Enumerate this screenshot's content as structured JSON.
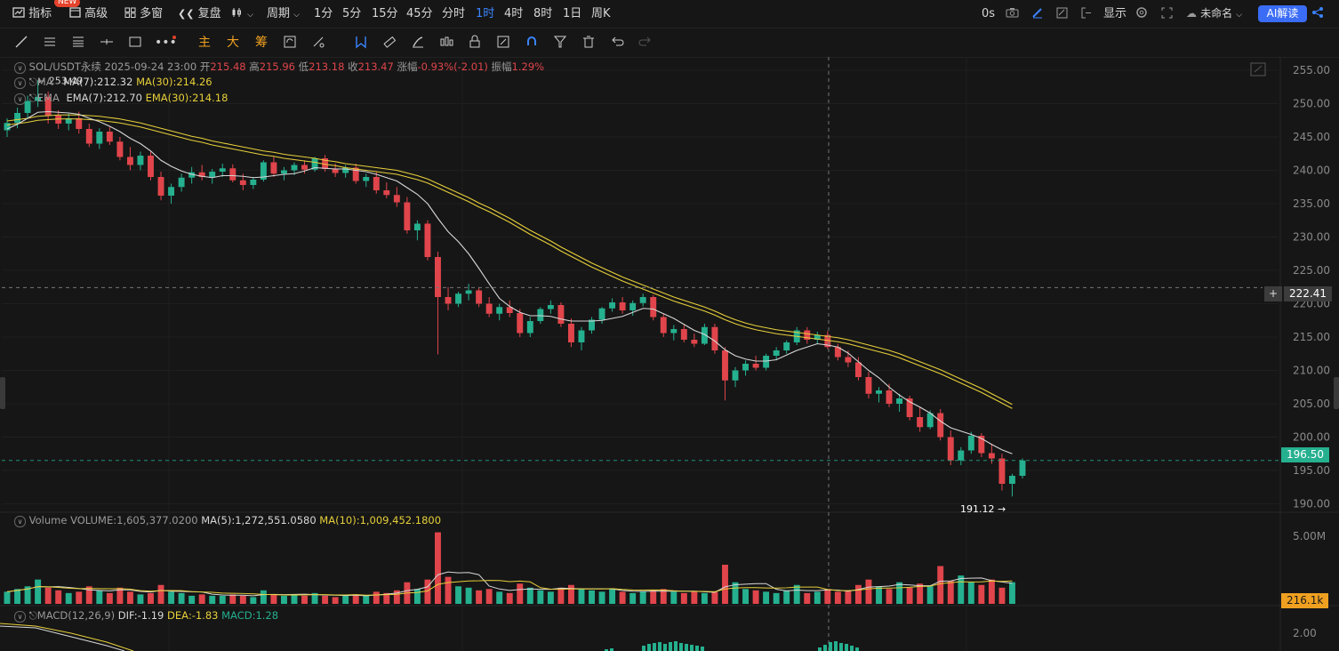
{
  "topbar": {
    "indicator": "指标",
    "new_badge": "NEW",
    "advanced": "高级",
    "multi_window": "多窗",
    "replay": "复盘",
    "period": "周期",
    "intervals": [
      "1分",
      "5分",
      "15分",
      "45分",
      "分时",
      "1时",
      "4时",
      "8时",
      "1日",
      "周K"
    ],
    "active_interval": "1时",
    "countdown": "0s",
    "display": "显示",
    "layout_name": "未命名",
    "ai_button": "AI解读"
  },
  "drawbar": {
    "main": "主",
    "big": "大",
    "chip": "筹"
  },
  "main_legend": {
    "symbol": "SOL/USDT永续",
    "datetime": "2025-09-24 23:00",
    "open_label": "开",
    "open": "215.48",
    "high_label": "高",
    "high": "215.96",
    "low_label": "低",
    "low": "213.18",
    "close_label": "收",
    "close": "213.47",
    "change_label": "涨幅",
    "change": "-0.93%(-2.01)",
    "amp_label": "振幅",
    "amp": "1.29%",
    "ma_name": "MA",
    "ma7": "MA(7):212.32",
    "ma30": "MA(30):214.26",
    "ema_name": "EMA",
    "ema7": "EMA(7):212.70",
    "ema30": "EMA(30):214.18",
    "max_marker": "253.49",
    "min_marker": "191.12"
  },
  "volume_legend": {
    "name": "Volume",
    "vol": "VOLUME:1,605,377.0200",
    "ma5": "MA(5):1,272,551.0580",
    "ma10": "MA(10):1,009,452.1800"
  },
  "macd_legend": {
    "name": "MACD(12,26,9)",
    "dif": "DIF:-1.19",
    "dea": "DEA:-1.83",
    "macd": "MACD:1.28"
  },
  "price_axis": [
    "255.00",
    "250.00",
    "245.00",
    "240.00",
    "235.00",
    "230.00",
    "225.00",
    "220.00",
    "215.00",
    "210.00",
    "205.00",
    "200.00",
    "195.00",
    "190.00"
  ],
  "crosshair_price": "222.41",
  "last_price": "196.50",
  "volume_axis": "5.00M",
  "last_volume": "216.1k",
  "macd_axis": "2.00",
  "colors": {
    "up": "#25b08f",
    "down": "#e0454b",
    "ma7": "#d8d8d8",
    "ma30": "#e6cf3a",
    "accent": "#3a84ff",
    "background": "#161616"
  },
  "chart_data": {
    "type": "candlestick",
    "symbol": "SOL/USDT永续",
    "interval": "1时",
    "ylim": [
      189,
      257
    ],
    "candles": [
      [
        246.0,
        247.8,
        245.0,
        247.1
      ],
      [
        247.1,
        249.4,
        246.3,
        248.6
      ],
      [
        248.6,
        251.2,
        247.9,
        250.4
      ],
      [
        250.4,
        253.5,
        249.5,
        251.0
      ],
      [
        251.0,
        251.8,
        247.0,
        248.2
      ],
      [
        248.2,
        249.0,
        246.2,
        247.0
      ],
      [
        247.0,
        248.5,
        246.0,
        247.8
      ],
      [
        247.8,
        248.8,
        245.5,
        246.2
      ],
      [
        246.2,
        247.0,
        243.5,
        244.0
      ],
      [
        244.0,
        246.3,
        243.2,
        245.8
      ],
      [
        245.8,
        246.5,
        243.8,
        244.3
      ],
      [
        244.3,
        245.0,
        241.5,
        242.0
      ],
      [
        242.0,
        243.5,
        240.0,
        240.8
      ],
      [
        240.8,
        242.8,
        240.0,
        242.2
      ],
      [
        242.2,
        242.9,
        238.5,
        239.0
      ],
      [
        239.0,
        239.8,
        235.5,
        236.2
      ],
      [
        236.2,
        238.0,
        235.0,
        237.5
      ],
      [
        237.5,
        239.5,
        236.8,
        238.9
      ],
      [
        238.9,
        240.5,
        238.0,
        239.7
      ],
      [
        239.7,
        240.8,
        238.5,
        239.0
      ],
      [
        239.0,
        240.2,
        238.0,
        239.8
      ],
      [
        239.8,
        241.0,
        239.0,
        240.3
      ],
      [
        240.3,
        240.9,
        238.2,
        238.5
      ],
      [
        238.5,
        239.5,
        237.0,
        237.8
      ],
      [
        237.8,
        239.0,
        237.2,
        238.6
      ],
      [
        238.6,
        241.5,
        238.3,
        241.2
      ],
      [
        241.2,
        242.0,
        239.0,
        239.5
      ],
      [
        239.5,
        240.5,
        238.5,
        240.0
      ],
      [
        240.0,
        241.2,
        239.3,
        240.8
      ],
      [
        240.8,
        241.5,
        239.5,
        240.1
      ],
      [
        240.1,
        242.0,
        239.8,
        241.8
      ],
      [
        241.8,
        242.3,
        239.8,
        240.2
      ],
      [
        240.2,
        241.0,
        239.0,
        239.6
      ],
      [
        239.6,
        240.8,
        238.9,
        240.4
      ],
      [
        240.4,
        241.0,
        238.0,
        238.4
      ],
      [
        238.4,
        239.5,
        237.5,
        239.0
      ],
      [
        239.0,
        239.8,
        236.5,
        237.0
      ],
      [
        237.0,
        238.2,
        235.8,
        236.3
      ],
      [
        236.3,
        237.5,
        234.5,
        235.2
      ],
      [
        235.2,
        236.0,
        230.5,
        231.0
      ],
      [
        231.0,
        232.5,
        229.5,
        232.0
      ],
      [
        232.0,
        232.5,
        226.5,
        227.0
      ],
      [
        227.0,
        227.8,
        212.4,
        221.0
      ],
      [
        221.0,
        222.5,
        219.0,
        220.0
      ],
      [
        220.0,
        221.8,
        219.5,
        221.5
      ],
      [
        221.5,
        223.0,
        220.5,
        222.0
      ],
      [
        222.0,
        222.5,
        219.5,
        220.0
      ],
      [
        220.0,
        221.0,
        218.0,
        218.5
      ],
      [
        218.5,
        220.0,
        217.5,
        219.5
      ],
      [
        219.5,
        220.5,
        218.0,
        218.6
      ],
      [
        218.6,
        219.2,
        215.0,
        215.6
      ],
      [
        215.6,
        218.0,
        215.0,
        217.4
      ],
      [
        217.4,
        219.5,
        217.0,
        219.2
      ],
      [
        219.2,
        220.5,
        218.5,
        219.8
      ],
      [
        219.8,
        220.2,
        216.5,
        217.0
      ],
      [
        217.0,
        217.8,
        213.5,
        214.2
      ],
      [
        214.2,
        216.5,
        213.0,
        216.0
      ],
      [
        216.0,
        218.0,
        215.5,
        217.6
      ],
      [
        217.6,
        219.5,
        217.0,
        219.3
      ],
      [
        219.3,
        220.8,
        218.8,
        220.2
      ],
      [
        220.2,
        221.0,
        218.5,
        219.0
      ],
      [
        219.0,
        220.5,
        218.2,
        220.1
      ],
      [
        220.1,
        221.5,
        219.6,
        221.0
      ],
      [
        221.0,
        221.3,
        217.5,
        218.0
      ],
      [
        218.0,
        218.5,
        215.0,
        215.6
      ],
      [
        215.6,
        216.8,
        214.5,
        216.2
      ],
      [
        216.2,
        216.9,
        214.2,
        214.6
      ],
      [
        214.6,
        215.5,
        213.5,
        214.0
      ],
      [
        214.0,
        217.0,
        213.8,
        216.5
      ],
      [
        216.5,
        217.0,
        212.5,
        213.0
      ],
      [
        213.0,
        213.5,
        205.5,
        208.5
      ],
      [
        208.5,
        210.5,
        207.5,
        210.0
      ],
      [
        210.0,
        211.5,
        209.2,
        211.0
      ],
      [
        211.0,
        212.2,
        210.0,
        210.4
      ],
      [
        210.4,
        212.5,
        210.0,
        212.2
      ],
      [
        212.2,
        213.5,
        211.5,
        213.0
      ],
      [
        213.0,
        214.5,
        212.5,
        214.2
      ],
      [
        214.2,
        216.5,
        213.8,
        216.0
      ],
      [
        216.0,
        216.5,
        214.0,
        214.6
      ],
      [
        214.6,
        215.8,
        214.0,
        215.3
      ],
      [
        215.3,
        215.9,
        213.2,
        213.5
      ],
      [
        213.5,
        214.0,
        211.5,
        212.0
      ],
      [
        212.0,
        213.0,
        210.5,
        211.2
      ],
      [
        211.2,
        212.0,
        208.5,
        209.0
      ],
      [
        209.0,
        209.8,
        205.8,
        206.5
      ],
      [
        206.5,
        207.5,
        205.2,
        207.0
      ],
      [
        207.0,
        208.0,
        204.5,
        205.0
      ],
      [
        205.0,
        206.5,
        203.8,
        205.8
      ],
      [
        205.8,
        206.2,
        202.5,
        203.0
      ],
      [
        203.0,
        204.5,
        200.8,
        201.5
      ],
      [
        201.5,
        204.0,
        201.2,
        203.6
      ],
      [
        203.6,
        204.2,
        199.5,
        200.0
      ],
      [
        200.0,
        201.0,
        195.8,
        196.5
      ],
      [
        196.5,
        198.5,
        195.8,
        198.0
      ],
      [
        198.0,
        200.8,
        197.5,
        200.2
      ],
      [
        200.2,
        200.6,
        197.0,
        197.6
      ],
      [
        197.6,
        199.0,
        196.0,
        196.8
      ],
      [
        196.8,
        197.5,
        192.0,
        193.0
      ],
      [
        193.0,
        194.5,
        191.1,
        194.2
      ],
      [
        194.2,
        196.8,
        193.8,
        196.5
      ]
    ],
    "ma7": [
      246.2,
      246.9,
      247.8,
      248.7,
      248.8,
      248.7,
      248.6,
      248.4,
      247.8,
      247.3,
      246.6,
      245.8,
      244.8,
      244.0,
      242.9,
      241.5,
      240.6,
      239.9,
      239.4,
      239.1,
      238.9,
      239.2,
      239.2,
      239.1,
      238.9,
      239.0,
      239.2,
      239.4,
      239.5,
      239.9,
      240.4,
      240.3,
      240.2,
      240.2,
      240.0,
      239.8,
      239.4,
      238.9,
      238.4,
      237.4,
      236.4,
      235.0,
      232.8,
      230.8,
      229.3,
      227.5,
      225.3,
      223.0,
      220.8,
      219.6,
      218.7,
      218.2,
      218.2,
      218.1,
      217.7,
      217.4,
      217.4,
      217.4,
      217.5,
      217.8,
      218.1,
      218.7,
      219.3,
      219.2,
      218.5,
      217.8,
      216.9,
      216.0,
      215.4,
      214.4,
      213.1,
      212.2,
      211.7,
      211.4,
      211.4,
      211.6,
      212.3,
      213.0,
      213.5,
      214.0,
      213.8,
      213.5,
      212.6,
      211.3,
      210.0,
      208.9,
      207.5,
      206.3,
      205.3,
      204.5,
      203.6,
      202.4,
      201.4,
      200.9,
      200.4,
      199.8,
      198.9,
      198.1,
      197.5
    ],
    "ma30": [
      246.8,
      247.0,
      247.2,
      247.5,
      247.6,
      247.7,
      247.7,
      247.7,
      247.6,
      247.5,
      247.3,
      247.1,
      246.8,
      246.5,
      246.1,
      245.7,
      245.3,
      244.9,
      244.5,
      244.2,
      243.8,
      243.5,
      243.2,
      242.9,
      242.6,
      242.3,
      242.1,
      241.8,
      241.6,
      241.4,
      241.2,
      240.9,
      240.7,
      240.4,
      240.2,
      240.0,
      239.8,
      239.6,
      239.4,
      239.0,
      238.6,
      238.1,
      237.4,
      236.7,
      236.0,
      235.3,
      234.5,
      233.8,
      233.0,
      232.2,
      231.3,
      230.4,
      229.6,
      228.8,
      227.9,
      227.1,
      226.3,
      225.5,
      224.8,
      224.1,
      223.4,
      222.8,
      222.2,
      221.6,
      221.0,
      220.4,
      219.9,
      219.4,
      218.9,
      218.3,
      217.6,
      217.0,
      216.5,
      216.1,
      215.8,
      215.5,
      215.3,
      215.1,
      214.9,
      214.7,
      214.5,
      214.3,
      214.0,
      213.6,
      213.2,
      212.8,
      212.4,
      211.9,
      211.3,
      210.7,
      210.1,
      209.5,
      208.8,
      208.1,
      207.4,
      206.7,
      205.9,
      205.1,
      204.3
    ],
    "volume": [
      0.9,
      1.1,
      1.3,
      1.8,
      1.2,
      1.0,
      0.8,
      0.9,
      1.3,
      1.0,
      0.8,
      1.2,
      0.9,
      0.7,
      0.8,
      1.4,
      0.9,
      0.8,
      0.6,
      0.7,
      0.6,
      0.6,
      0.7,
      0.6,
      0.5,
      1.0,
      0.7,
      0.6,
      0.7,
      0.6,
      0.8,
      0.6,
      0.5,
      0.6,
      0.7,
      0.6,
      0.9,
      0.8,
      1.0,
      1.6,
      1.1,
      1.8,
      5.3,
      2.0,
      1.3,
      1.2,
      1.0,
      1.1,
      0.9,
      0.8,
      1.5,
      1.2,
      1.0,
      0.9,
      1.2,
      1.4,
      1.1,
      1.0,
      0.9,
      1.1,
      0.9,
      0.8,
      0.9,
      1.0,
      1.1,
      0.9,
      0.8,
      0.9,
      0.8,
      0.9,
      2.9,
      1.6,
      1.1,
      1.0,
      0.9,
      0.8,
      1.0,
      1.4,
      0.8,
      0.9,
      1.1,
      0.9,
      1.0,
      1.4,
      1.8,
      1.3,
      1.1,
      1.6,
      1.2,
      1.5,
      1.3,
      2.8,
      1.7,
      2.1,
      1.6,
      1.4,
      1.8,
      1.2,
      1.605
    ]
  }
}
